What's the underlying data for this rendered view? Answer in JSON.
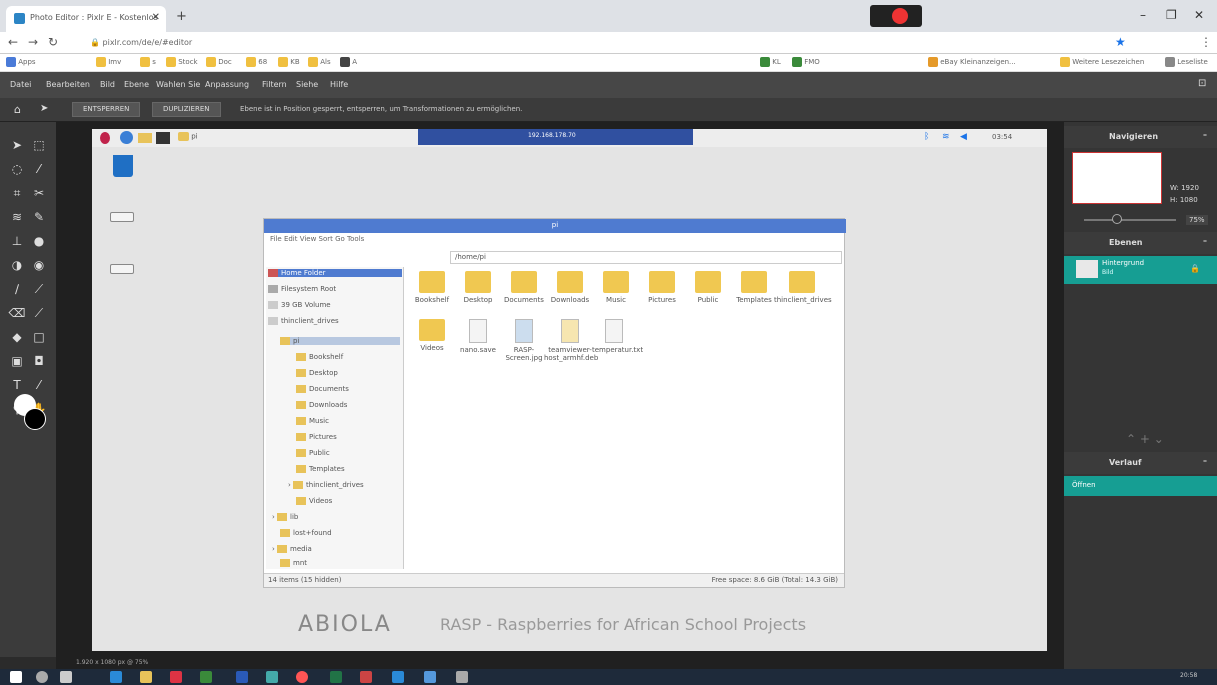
{
  "browser": {
    "tab_title": "Photo Editor : Pixlr E - Kostenlos",
    "address": "pixlr.com/de/e/#editor",
    "bookmarks": [
      "Apps",
      "Imv",
      "s",
      "Stock",
      "Doc",
      "68",
      "KB",
      "Als",
      "A",
      "KL",
      "FMO",
      "eBay Kleinanzeigen...",
      "Weitere Lesezeichen",
      "Leseliste"
    ]
  },
  "photopea": {
    "menu": [
      "Datei",
      "Bearbeiten",
      "Bild",
      "Ebene",
      "Wahlen Sie",
      "Anpassung",
      "Filtern",
      "Siehe",
      "Hilfe"
    ],
    "unlock_button": "ENTSPERREN",
    "duplicate_button": "DUPLIZIEREN",
    "message": "Ebene ist in Position gesperrt, entsperren, um Transformationen zu ermöglichen.",
    "status": "1.920 x 1080 px @ 75%",
    "navigator": {
      "title": "Navigieren",
      "w": "W: 1920",
      "h": "H: 1080",
      "zoom": "75%"
    },
    "layers": {
      "title": "Ebenen",
      "layer_name": "Hintergrund",
      "layer_sub": "Bild"
    },
    "history": {
      "title": "Verlauf",
      "item": "Öffnen"
    }
  },
  "desktop": {
    "top_folder": "pi",
    "clock": "03:54",
    "term_title": "192.168.178.70",
    "fm": {
      "title": "pi",
      "menu": "File  Edit  View  Sort  Go  Tools",
      "path": "/home/pi",
      "sidebar": [
        "Home Folder",
        "Filesystem Root",
        "39 GB Volume",
        "thinclient_drives",
        "pi",
        "Bookshelf",
        "Desktop",
        "Documents",
        "Downloads",
        "Music",
        "Pictures",
        "Public",
        "Templates",
        "thinclient_drives",
        "Videos",
        "lib",
        "lost+found",
        "media",
        "mnt"
      ],
      "files": [
        "Bookshelf",
        "Desktop",
        "Documents",
        "Downloads",
        "Music",
        "Pictures",
        "Public",
        "Templates",
        "thinclient_drives",
        "Videos",
        "nano.save",
        "RASP-Screen.jpg",
        "teamviewer-host_armhf.deb",
        "temperatur.txt"
      ],
      "status_left": "14 items (15 hidden)",
      "status_right": "Free space: 8.6 GiB (Total: 14.3 GiB)"
    },
    "brand": "ABIOLA",
    "brand_tagline": "RASP - Raspberries for African School Projects"
  },
  "taskbar": {
    "clock": "20:58"
  }
}
